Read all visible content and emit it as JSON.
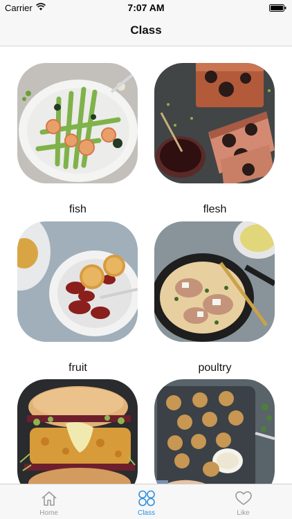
{
  "status_bar": {
    "carrier": "Carrier",
    "time": "7:07 AM"
  },
  "nav": {
    "title": "Class"
  },
  "categories": [
    {
      "label": "fish",
      "image": "asparagus-shrimp-plate"
    },
    {
      "label": "flesh",
      "image": "meat-terrine-with-sauce"
    },
    {
      "label": "fruit",
      "image": "fruit-compote-bowl"
    },
    {
      "label": "poultry",
      "image": "chicken-skillet"
    },
    {
      "label": "",
      "image": "veggie-burger"
    },
    {
      "label": "",
      "image": "baked-balls-tray"
    }
  ],
  "tabs": [
    {
      "label": "Home",
      "icon": "home-icon",
      "active": false
    },
    {
      "label": "Class",
      "icon": "class-grid-icon",
      "active": true
    },
    {
      "label": "Like",
      "icon": "heart-icon",
      "active": false
    }
  ],
  "colors": {
    "accent": "#2b8fe0",
    "inactive_tab": "#9a9a9a",
    "bar_background": "#f7f7f7"
  }
}
